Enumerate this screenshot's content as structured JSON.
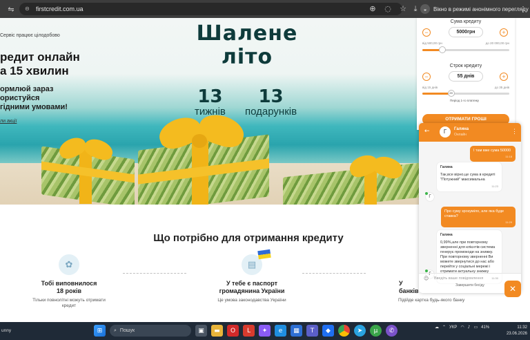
{
  "browser": {
    "url": "firstcredit.com.ua",
    "incognito_label": "Вікно в режимі анонімного перегляду"
  },
  "hero": {
    "eyebrow": "Сервіс працює цілодобово",
    "headline_line1": "редит онлайн",
    "headline_line2": "а 15 хвилин",
    "sub_line1": "ормлюй зараз",
    "sub_line2": "ористуйся",
    "sub_line3": "гідними умовами!",
    "conditions_link": "ли акції",
    "promo_line1": "Шалене",
    "promo_line2": "літо",
    "weeks_number": "13",
    "weeks_label": "тижнів",
    "gifts_number": "13",
    "gifts_label": "подарунків"
  },
  "requirements": {
    "title": "Що потрібно для отримання кредиту",
    "items": [
      {
        "title": "Тобі виповнилося\n18 років",
        "desc": "Тільки повнолітні можуть отримати\nкредит",
        "icon": "age-badge-icon"
      },
      {
        "title": "У тебе є паспорт\nгромадянина України",
        "desc": "Це умова законодавства України",
        "icon": "passport-icon"
      },
      {
        "title": "У\nбанків",
        "desc": "Підійде картка будь-якого банку",
        "icon": "bank-card-icon"
      }
    ]
  },
  "calculator": {
    "amount_label": "Сума кредиту",
    "amount_value": "5000грн",
    "amount_min": "від 500,00 грн",
    "amount_max": "до 20 000,00 грн",
    "amount_fraction": 0.23,
    "term_label": "Строк кредиту",
    "term_value": "55 днів",
    "term_min": "від 15 днів",
    "term_max": "до 35 днів",
    "term_thumb": "20",
    "term_fraction": 0.33,
    "period_note": "Період 1-го платежу",
    "submit_label": "ОТРИМАТИ ГРОШІ"
  },
  "chat": {
    "agent_name": "Галина",
    "agent_status": "Онлайн",
    "agent_initial": "Г",
    "messages": [
      {
        "dir": "out",
        "text": "І там вже сума 50000",
        "time": "11:18"
      },
      {
        "dir": "in",
        "author": "Галина",
        "text": "Так,все вірно,це сума в кредиті \"Потужний\" максимальна",
        "time": "11:23"
      },
      {
        "dir": "out",
        "text": "Про суму зрозуміло, але яка буде ставка?",
        "time": "11:29"
      },
      {
        "dir": "in",
        "author": "Галина",
        "text": "0,99%,але при повторному зверненні для клієнтів система генерує промокоди на знижку. При повторному зверненні Ви можете звернутися до нас або перейти у соціальні мережі і отримати актуальну знижку",
        "time": "11:30"
      }
    ],
    "input_placeholder": "Введіть ваше повідомлення",
    "end_chat": "Завершити бесіду"
  },
  "taskbar": {
    "weather": "unny",
    "search_placeholder": "Пошук",
    "language": "УКР",
    "battery": "41%",
    "time": "11:32",
    "date": "23.06.2026"
  },
  "colors": {
    "accent": "#f28a22",
    "promo_text": "#0e3b3b",
    "taskbar": "#1f2a37"
  }
}
